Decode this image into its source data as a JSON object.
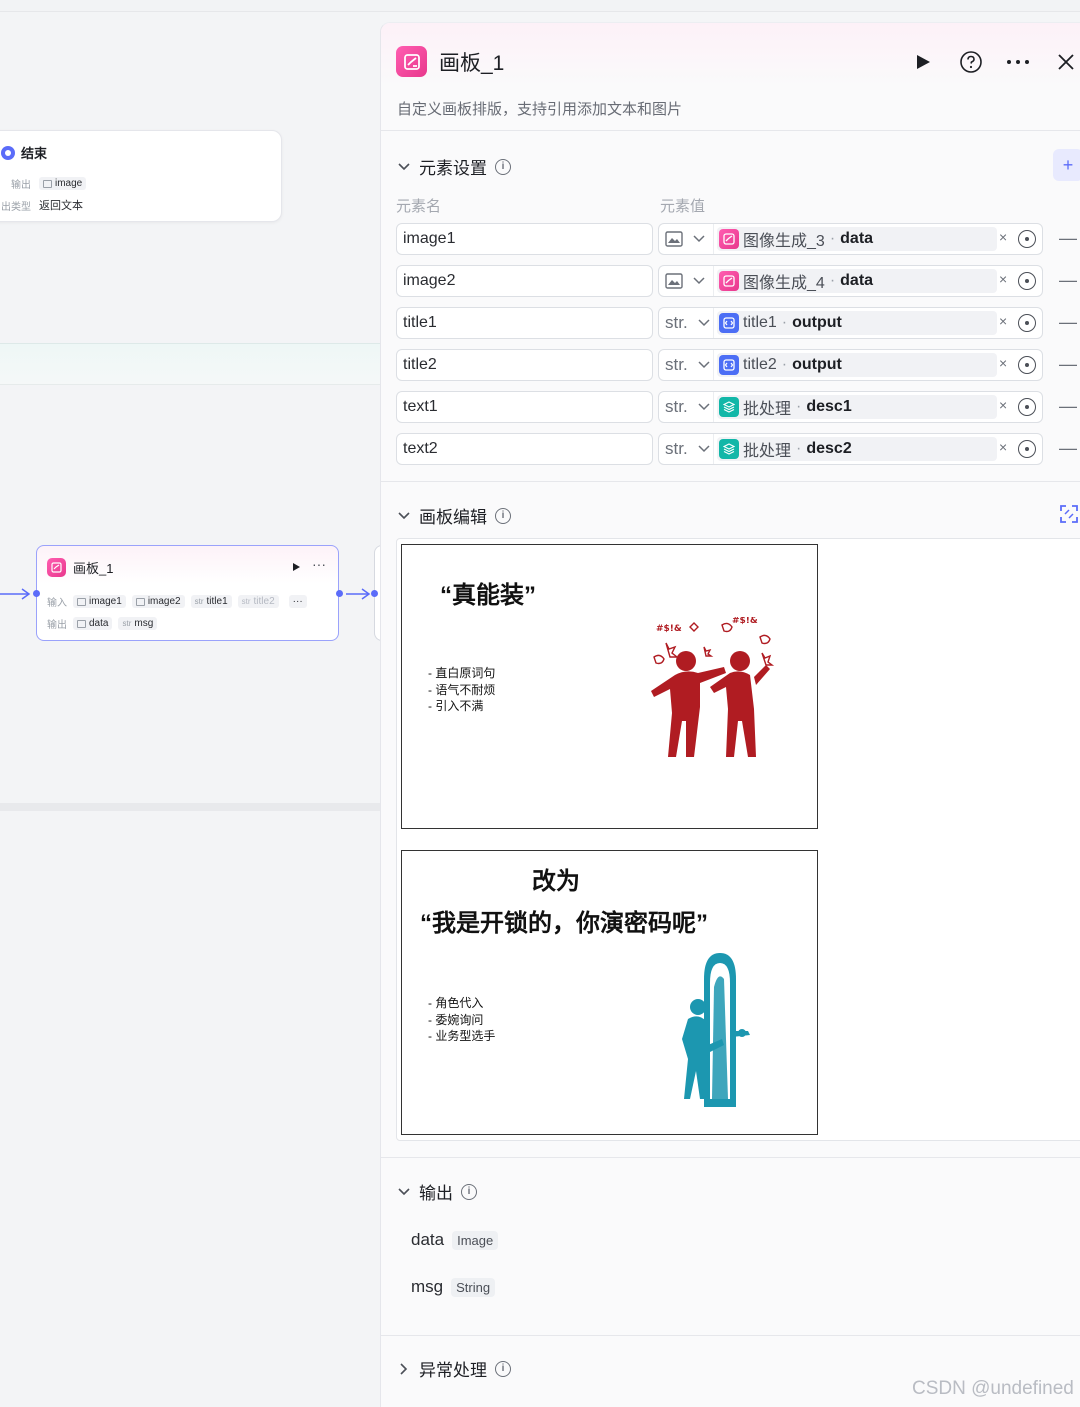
{
  "canvas": {
    "end_node": {
      "title": "结束",
      "output_label": "输出",
      "output_value": "image",
      "type_label": "出类型",
      "type_value": "返回文本"
    },
    "board_node": {
      "title": "画板_1",
      "input_label": "输入",
      "inputs": [
        {
          "type": "image",
          "name": "image1"
        },
        {
          "type": "image",
          "name": "image2"
        },
        {
          "type": "str",
          "name": "title1"
        },
        {
          "type": "str",
          "name": "title2"
        }
      ],
      "more": "···",
      "output_label": "输出",
      "outputs": [
        {
          "type": "image",
          "name": "data"
        },
        {
          "type": "str",
          "name": "msg"
        }
      ]
    }
  },
  "panel": {
    "title": "画板_1",
    "description": "自定义画板排版，支持引用添加文本和图片",
    "elements_section": {
      "title": "元素设置",
      "col_name": "元素名",
      "col_value": "元素值",
      "add_label": "+",
      "rows": [
        {
          "name": "image1",
          "type": "image",
          "type_label": "",
          "source": "图像生成_3",
          "field": "data",
          "source_kind": "image-gen"
        },
        {
          "name": "image2",
          "type": "image",
          "type_label": "",
          "source": "图像生成_4",
          "field": "data",
          "source_kind": "image-gen"
        },
        {
          "name": "title1",
          "type": "str",
          "type_label": "str.",
          "source": "title1",
          "field": "output",
          "source_kind": "code"
        },
        {
          "name": "title2",
          "type": "str",
          "type_label": "str.",
          "source": "title2",
          "field": "output",
          "source_kind": "code"
        },
        {
          "name": "text1",
          "type": "str",
          "type_label": "str.",
          "source": "批处理",
          "field": "desc1",
          "source_kind": "batch"
        },
        {
          "name": "text2",
          "type": "str",
          "type_label": "str.",
          "source": "批处理",
          "field": "desc2",
          "source_kind": "batch"
        }
      ]
    },
    "board_section": {
      "title": "画板编辑",
      "slides": [
        {
          "title": "“真能装”",
          "bullets": "- 直白原词句\n- 语气不耐烦\n- 引入不满",
          "illustration": "two-figures-arguing",
          "color": "#b01c22"
        },
        {
          "title_top": "改为",
          "title": "“我是开锁的，你演密码呢”",
          "bullets": "- 角色代入\n- 委婉询问\n- 业务型选手",
          "illustration": "person-opening-door",
          "color": "#1c97b0"
        }
      ]
    },
    "output_section": {
      "title": "输出",
      "items": [
        {
          "name": "data",
          "type": "Image"
        },
        {
          "name": "msg",
          "type": "String"
        }
      ]
    },
    "exception_section": {
      "title": "异常处理"
    }
  },
  "watermark": "CSDN @undefined",
  "colors": {
    "accent": "#5b6cf9",
    "pink": "#ec3f94",
    "teal": "#12b7a8"
  }
}
